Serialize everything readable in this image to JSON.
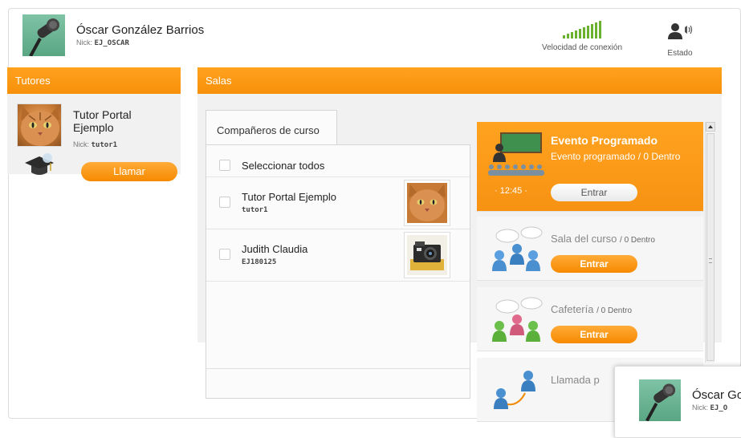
{
  "user": {
    "name": "Óscar González Barrios",
    "nick_label": "Nick:",
    "nick": "EJ_OSCAR"
  },
  "status": {
    "connection_label": "Velocidad de conexión",
    "estado_label": "Estado"
  },
  "tutores": {
    "title": "Tutores",
    "tutor_name": "Tutor Portal Ejemplo",
    "nick_label": "Nick:",
    "tutor_nick": "tutor1",
    "call_button": "Llamar"
  },
  "salas": {
    "title": "Salas",
    "tab_label": "Compañeros de curso",
    "select_all": "Seleccionar todos",
    "classmates": [
      {
        "name": "Tutor Portal Ejemplo",
        "nick": "tutor1"
      },
      {
        "name": "Judith Claudia",
        "nick": "EJ180125"
      }
    ],
    "rooms": [
      {
        "title": "Evento Programado",
        "subtitle": "Evento programado / 0 Dentro",
        "time": "· 12:45 ·",
        "button": "Entrar"
      },
      {
        "title": "Sala del curso",
        "count": "/ 0 Dentro",
        "button": "Entrar"
      },
      {
        "title": "Cafetería",
        "count": "/ 0 Dentro",
        "button": "Entrar"
      },
      {
        "title": "Llamada p"
      }
    ]
  },
  "popup": {
    "name": "Óscar Go",
    "nick_label": "Nick:",
    "nick": "EJ_O"
  },
  "colors": {
    "accent": "#f7900a",
    "signal": "#6ab22d"
  }
}
